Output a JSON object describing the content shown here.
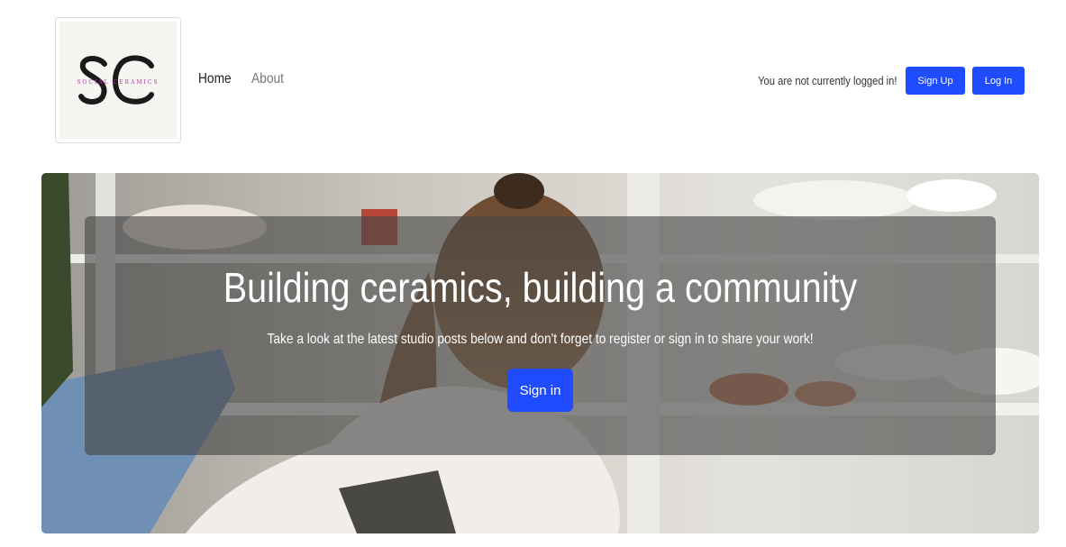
{
  "brand": {
    "logo_letters": "SC",
    "logo_tagline": "SOCIAL CERAMICS",
    "tagline_color": "#b03aa0"
  },
  "nav": {
    "items": [
      {
        "label": "Home"
      },
      {
        "label": "About"
      }
    ]
  },
  "auth": {
    "status_text": "You are not currently logged in!",
    "signup_label": "Sign Up",
    "login_label": "Log In",
    "accent": "#1f4cff"
  },
  "hero": {
    "title": "Building ceramics, building a community",
    "subtitle": "Take a look at the latest studio posts below and don't forget to register or sign in to share your work!",
    "cta_label": "Sign in"
  }
}
